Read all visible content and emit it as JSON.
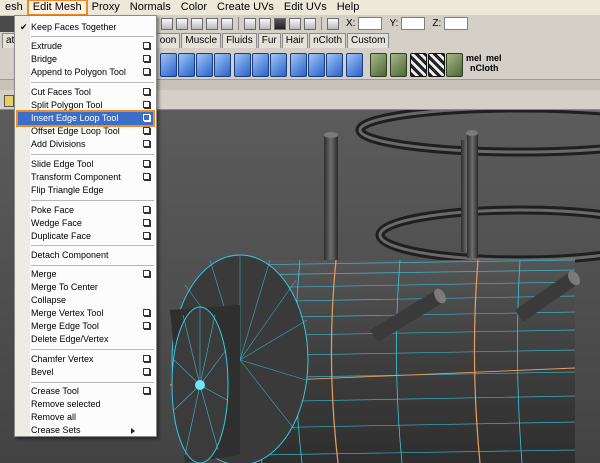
{
  "menubar": {
    "items": [
      "esh",
      "Edit Mesh",
      "Proxy",
      "Normals",
      "Color",
      "Create UVs",
      "Edit UVs",
      "Help"
    ],
    "active": "Edit Mesh"
  },
  "toolbar": {
    "x_label": "X:",
    "y_label": "Y:",
    "z_label": "Z:"
  },
  "shelf_tabs": [
    "ation",
    "oon",
    "Muscle",
    "Fluids",
    "Fur",
    "Hair",
    "nCloth",
    "Custom"
  ],
  "shelf": {
    "mel_label": "mel",
    "ncloth_label": "nCloth"
  },
  "edit_mesh_menu": {
    "items": [
      {
        "label": "Keep Faces Together",
        "checked": true
      },
      {
        "label": "Extrude",
        "option_box": true
      },
      {
        "label": "Bridge",
        "option_box": true
      },
      {
        "label": "Append to Polygon Tool",
        "option_box": true
      },
      {
        "label": "Cut Faces Tool",
        "option_box": true
      },
      {
        "label": "Split Polygon Tool",
        "option_box": true
      },
      {
        "label": "Insert Edge Loop Tool",
        "option_box": true,
        "highlighted": true
      },
      {
        "label": "Offset Edge Loop Tool",
        "option_box": true
      },
      {
        "label": "Add Divisions",
        "option_box": true
      },
      {
        "label": "Slide Edge Tool",
        "option_box": true
      },
      {
        "label": "Transform Component",
        "option_box": true
      },
      {
        "label": "Flip Triangle Edge"
      },
      {
        "label": "Poke Face",
        "option_box": true
      },
      {
        "label": "Wedge Face",
        "option_box": true
      },
      {
        "label": "Duplicate Face",
        "option_box": true
      },
      {
        "label": "Detach Component"
      },
      {
        "label": "Merge",
        "option_box": true
      },
      {
        "label": "Merge To Center"
      },
      {
        "label": "Collapse"
      },
      {
        "label": "Merge Vertex Tool",
        "option_box": true
      },
      {
        "label": "Merge Edge Tool",
        "option_box": true
      },
      {
        "label": "Delete Edge/Vertex"
      },
      {
        "label": "Chamfer Vertex",
        "option_box": true
      },
      {
        "label": "Bevel",
        "option_box": true
      },
      {
        "label": "Crease Tool",
        "option_box": true
      },
      {
        "label": "Remove selected"
      },
      {
        "label": "Remove all"
      },
      {
        "label": "Crease Sets",
        "submenu": true
      }
    ]
  },
  "colors": {
    "highlight_outline": "#f08a24",
    "wireframe": "#39c8e0",
    "edge_loop": "#e8a060",
    "viewport_bg": "#4f4f4f"
  }
}
